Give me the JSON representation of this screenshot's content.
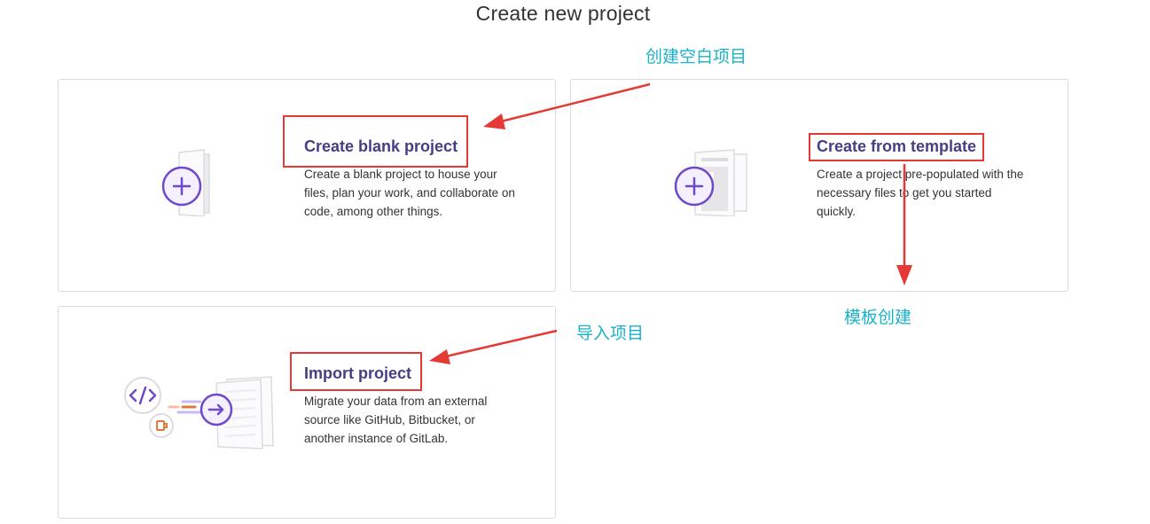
{
  "page": {
    "title": "Create new project"
  },
  "cards": {
    "blank": {
      "title": "Create blank project",
      "description": "Create a blank project to house your files, plan your work, and collaborate on code, among other things.",
      "icon": "plus-icon"
    },
    "template": {
      "title": "Create from template",
      "description": "Create a project pre-populated with the necessary files to get you started quickly.",
      "icon": "plus-icon"
    },
    "import": {
      "title": "Import project",
      "description": "Migrate your data from an external source like GitHub, Bitbucket, or another instance of GitLab.",
      "icon": "arrow-right-icon"
    }
  },
  "annotations": {
    "blank": "创建空白项目",
    "template": "模板创建",
    "import": "导入项目"
  },
  "colors": {
    "title_purple": "#433f85",
    "icon_purple": "#6e49cb",
    "annotation_cyan": "#1ab2c8",
    "highlight_red": "#e53935"
  }
}
